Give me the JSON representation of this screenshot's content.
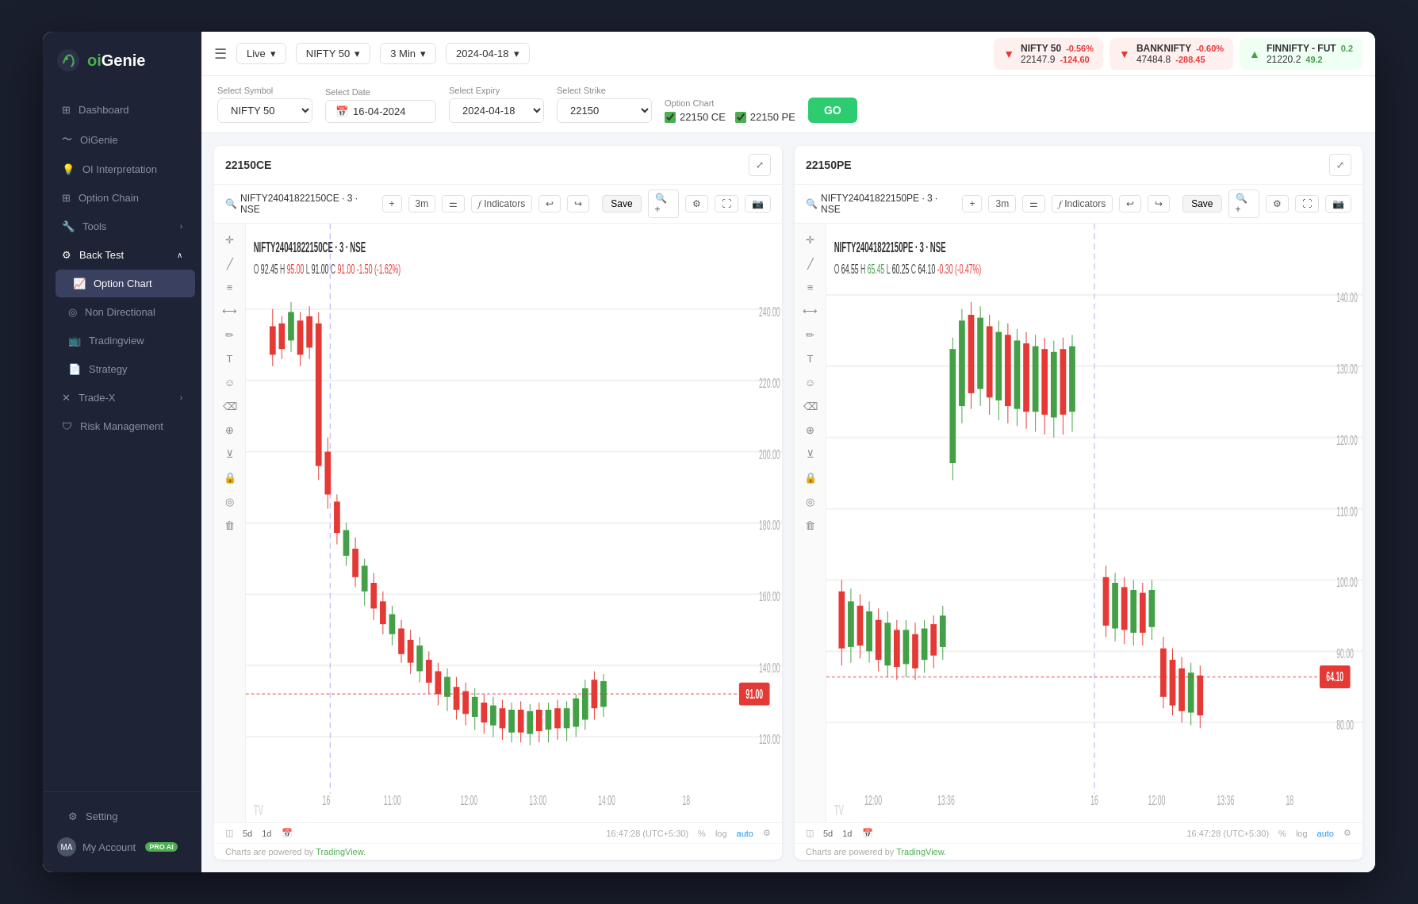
{
  "app": {
    "title": "oiGenie",
    "logo_text_o": "oi",
    "logo_text_g": "Genie"
  },
  "sidebar": {
    "items": [
      {
        "label": "Dashboard",
        "icon": "grid-icon",
        "active": false
      },
      {
        "label": "OiGenie",
        "icon": "wave-icon",
        "active": false
      },
      {
        "label": "OI Interpretation",
        "icon": "lightbulb-icon",
        "active": false
      },
      {
        "label": "Option Chain",
        "icon": "table-icon",
        "active": false
      }
    ],
    "tools": {
      "label": "Tools",
      "icon": "wrench-icon"
    },
    "backtest": {
      "label": "Back Test",
      "icon": "chart-icon",
      "expanded": true,
      "children": [
        {
          "label": "Option Chart",
          "icon": "line-chart-icon",
          "active": true
        },
        {
          "label": "Non Directional",
          "icon": "target-icon",
          "active": false
        },
        {
          "label": "Tradingview",
          "icon": "tv-icon",
          "active": false
        },
        {
          "label": "Strategy",
          "icon": "doc-icon",
          "active": false
        }
      ]
    },
    "trade_x": {
      "label": "Trade-X",
      "icon": "x-icon"
    },
    "risk_management": {
      "label": "Risk Management",
      "icon": "shield-icon"
    },
    "bottom": {
      "setting": "Setting",
      "my_account": "My Account",
      "pro_ai": "PRO AI"
    }
  },
  "topbar": {
    "mode": "Live",
    "symbol": "NIFTY 50",
    "interval": "3 Min",
    "date": "2024-04-18",
    "markets": [
      {
        "name": "NIFTY 50",
        "price": "22147.9",
        "change": "-0.56%",
        "change_pts": "-124.60",
        "direction": "down",
        "color": "red"
      },
      {
        "name": "BANKNIFTY",
        "price": "47484.8",
        "change": "-0.60%",
        "change_pts": "-288.45",
        "direction": "down",
        "color": "red"
      },
      {
        "name": "FINNIFTY - FUT",
        "price": "21220.2",
        "change": "0.2",
        "change_pts": "49.2",
        "direction": "up",
        "color": "green"
      }
    ]
  },
  "filters": {
    "select_symbol_label": "Select Symbol",
    "select_symbol_value": "NIFTY 50",
    "select_date_label": "Select Date",
    "select_date_value": "16-04-2024",
    "select_expiry_label": "Select Expiry",
    "select_expiry_value": "2024-04-18",
    "select_strike_label": "Select Strike",
    "select_strike_value": "22150",
    "option_chart_label": "Option Chart",
    "ce_label": "22150 CE",
    "pe_label": "22150 PE",
    "go_button": "GO"
  },
  "chart_ce": {
    "title": "22150CE",
    "symbol": "NIFTY24041822150CE · 3 · NSE",
    "ohlc": "O 92.45  H 95.00  L 91.00  C 91.00  -1.50  (-1.62%)",
    "interval": "3m",
    "indicators_label": "Indicators",
    "save_label": "Save",
    "time_display": "16:47:28 (UTC+5:30)",
    "current_price": "91.00",
    "price_color": "red",
    "powered_by": "Charts are powered by",
    "tradingview_link": "TradingView."
  },
  "chart_pe": {
    "title": "22150PE",
    "symbol": "NIFTY24041822150PE · 3 · NSE",
    "ohlc": "O 64.55  H 65.45  L 60.25  C 64.10  -0.30  (-0.47%)",
    "interval": "3m",
    "indicators_label": "Indicators",
    "save_label": "Save",
    "time_display": "16:47:28 (UTC+5:30)",
    "current_price": "64.10",
    "price_color": "red",
    "powered_by": "Charts are powered by",
    "tradingview_link": "TradingView."
  }
}
